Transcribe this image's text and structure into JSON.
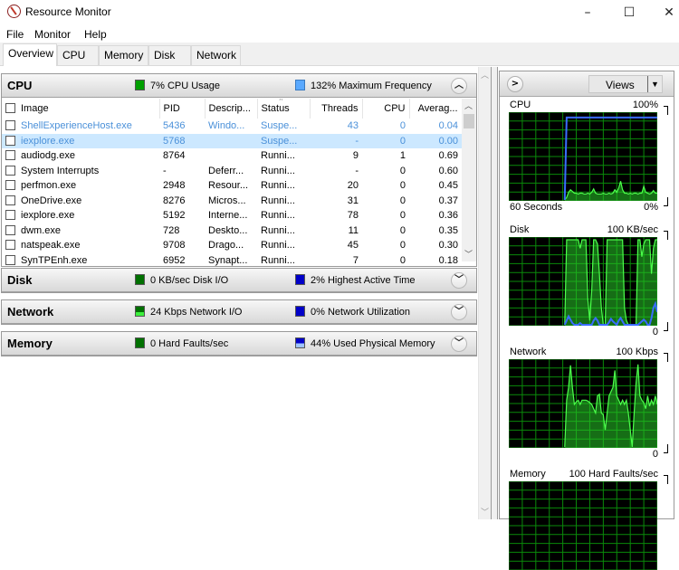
{
  "window": {
    "title": "Resource Monitor",
    "minimize": "–",
    "maximize": "☐",
    "close": "✕"
  },
  "menu": [
    "File",
    "Monitor",
    "Help"
  ],
  "tabs": [
    {
      "label": "Overview",
      "active": true
    },
    {
      "label": "CPU",
      "active": false
    },
    {
      "label": "Memory",
      "active": false
    },
    {
      "label": "Disk",
      "active": false
    },
    {
      "label": "Network",
      "active": false
    }
  ],
  "colors": {
    "green_indicator": "#00a000",
    "blue_indicator": "#0000c8",
    "light_blue_indicator": "#5aa9ff",
    "suspended_text": "#4a90d9",
    "selected_row": "#cce8ff",
    "graph_line_green": "#4cff4c",
    "graph_line_blue": "#3a6cff"
  },
  "cpu_section": {
    "title": "CPU",
    "stat1": "7% CPU Usage",
    "stat2": "132% Maximum Frequency",
    "expander": "^",
    "columns": [
      "Image",
      "PID",
      "Descrip...",
      "Status",
      "Threads",
      "CPU",
      "Averag..."
    ],
    "rows": [
      {
        "image": "ShellExperienceHost.exe",
        "pid": "5436",
        "desc": "Windo...",
        "status": "Suspe...",
        "threads": "43",
        "cpu": "0",
        "avg": "0.04",
        "state": "suspended"
      },
      {
        "image": "iexplore.exe",
        "pid": "5768",
        "desc": "",
        "status": "Suspe...",
        "threads": "-",
        "cpu": "0",
        "avg": "0.00",
        "state": "suspended-selected"
      },
      {
        "image": "audiodg.exe",
        "pid": "8764",
        "desc": "",
        "status": "Runni...",
        "threads": "9",
        "cpu": "1",
        "avg": "0.69",
        "state": "normal"
      },
      {
        "image": "System Interrupts",
        "pid": "-",
        "desc": "Deferr...",
        "status": "Runni...",
        "threads": "-",
        "cpu": "0",
        "avg": "0.60",
        "state": "normal"
      },
      {
        "image": "perfmon.exe",
        "pid": "2948",
        "desc": "Resour...",
        "status": "Runni...",
        "threads": "20",
        "cpu": "0",
        "avg": "0.45",
        "state": "normal"
      },
      {
        "image": "OneDrive.exe",
        "pid": "8276",
        "desc": "Micros...",
        "status": "Runni...",
        "threads": "31",
        "cpu": "0",
        "avg": "0.37",
        "state": "normal"
      },
      {
        "image": "iexplore.exe",
        "pid": "5192",
        "desc": "Interne...",
        "status": "Runni...",
        "threads": "78",
        "cpu": "0",
        "avg": "0.36",
        "state": "normal"
      },
      {
        "image": "dwm.exe",
        "pid": "728",
        "desc": "Deskto...",
        "status": "Runni...",
        "threads": "11",
        "cpu": "0",
        "avg": "0.35",
        "state": "normal"
      },
      {
        "image": "natspeak.exe",
        "pid": "9708",
        "desc": "Drago...",
        "status": "Runni...",
        "threads": "45",
        "cpu": "0",
        "avg": "0.30",
        "state": "normal"
      },
      {
        "image": "SynTPEnh.exe",
        "pid": "6952",
        "desc": "Synapt...",
        "status": "Runni...",
        "threads": "7",
        "cpu": "0",
        "avg": "0.18",
        "state": "normal"
      }
    ]
  },
  "disk_section": {
    "title": "Disk",
    "stat1": "0 KB/sec Disk I/O",
    "stat2": "2% Highest Active Time",
    "expander": "v"
  },
  "network_section": {
    "title": "Network",
    "stat1": "24 Kbps Network I/O",
    "stat2": "0% Network Utilization",
    "expander": "v"
  },
  "memory_section": {
    "title": "Memory",
    "stat1": "0 Hard Faults/sec",
    "stat2": "44% Used Physical Memory",
    "expander": "v"
  },
  "right_panel": {
    "collapse": ">",
    "views_label": "Views",
    "views_dropdown": "▼",
    "graphs": [
      {
        "name": "CPU",
        "max": "100%",
        "bottom_left": "60 Seconds",
        "bottom_right": "0%",
        "green": [
          0,
          0,
          0,
          0,
          0,
          0,
          0,
          0,
          0,
          0,
          0,
          0,
          0,
          0,
          0,
          0,
          0,
          0,
          0,
          0,
          0,
          0,
          0,
          0,
          0,
          0,
          0,
          0,
          0,
          0,
          0,
          0,
          0,
          0,
          0,
          0,
          0,
          0,
          0,
          0,
          0,
          0,
          0,
          0,
          0,
          0,
          0,
          0,
          0,
          0,
          0,
          0,
          0,
          0,
          0,
          0,
          0,
          0,
          0,
          0,
          0,
          0,
          0,
          0,
          0,
          0,
          0,
          0,
          0,
          0,
          0,
          0,
          0,
          0,
          0,
          0,
          0,
          0,
          0,
          0,
          0,
          0,
          0,
          0,
          0,
          0,
          0,
          0,
          0,
          0,
          0,
          0,
          0,
          0,
          0,
          0,
          0,
          0,
          0,
          0,
          0,
          0,
          0,
          0,
          0,
          0,
          0,
          0,
          0,
          0,
          0,
          0,
          0,
          0,
          0,
          0,
          0,
          0,
          0,
          0,
          0,
          0,
          0,
          0,
          0,
          0,
          0,
          0,
          0,
          0,
          0,
          0,
          0,
          0,
          0,
          0,
          0,
          0,
          0,
          0,
          0,
          0,
          0,
          0,
          0,
          0,
          0,
          0,
          0,
          0,
          0,
          0,
          0,
          0,
          0,
          0,
          0,
          0,
          0,
          0,
          0,
          0,
          0,
          0,
          0,
          0,
          0,
          0,
          0,
          0,
          0,
          0,
          0,
          0,
          0,
          0,
          0,
          0,
          0,
          0,
          0,
          0,
          0,
          0,
          0,
          0,
          0,
          0,
          0,
          0,
          0,
          0,
          0,
          0,
          0,
          0,
          0,
          0,
          0,
          0,
          0,
          0,
          0,
          0,
          0,
          0,
          0,
          0
        ],
        "green_series": [
          0,
          0,
          0,
          0,
          0,
          0,
          0,
          0,
          0,
          0,
          0,
          0,
          0,
          0,
          0,
          0,
          0,
          0,
          0,
          0,
          0,
          0,
          0,
          0,
          0,
          0,
          0,
          0,
          0,
          0,
          3,
          9,
          12,
          10,
          8,
          8,
          7,
          8,
          8,
          7,
          7,
          8,
          7,
          9,
          13,
          8,
          7,
          7,
          7,
          8,
          7,
          7,
          8,
          7,
          8,
          12,
          9,
          14,
          22,
          12,
          8,
          8,
          7,
          8,
          7,
          8,
          8,
          7,
          8,
          8,
          16,
          9,
          8,
          7,
          8,
          11,
          8,
          8
        ],
        "blue_series": [
          0,
          0,
          0,
          0,
          0,
          0,
          0,
          0,
          0,
          0,
          0,
          0,
          0,
          0,
          0,
          0,
          0,
          0,
          0,
          0,
          0,
          0,
          0,
          0,
          0,
          0,
          0,
          0,
          0,
          0,
          97,
          97,
          97,
          97,
          97,
          97,
          97,
          97,
          97,
          97,
          97,
          97,
          97,
          97,
          97,
          97,
          97,
          97,
          97,
          97,
          97,
          97,
          97,
          97,
          97,
          97,
          97,
          97,
          97,
          97,
          97,
          97,
          97,
          97,
          97,
          97,
          97,
          97,
          97,
          97,
          97,
          97,
          97,
          97,
          97,
          97,
          97,
          97
        ]
      },
      {
        "name": "Disk",
        "max": "100 KB/sec",
        "bottom_left": "",
        "bottom_right": "0",
        "green_series": [
          0,
          0,
          0,
          0,
          0,
          0,
          0,
          0,
          0,
          0,
          0,
          0,
          0,
          0,
          0,
          0,
          0,
          0,
          0,
          0,
          0,
          0,
          0,
          0,
          0,
          0,
          0,
          0,
          0,
          0,
          100,
          100,
          100,
          100,
          100,
          100,
          100,
          90,
          100,
          100,
          100,
          30,
          5,
          40,
          100,
          100,
          95,
          60,
          20,
          0,
          0,
          100,
          100,
          100,
          100,
          100,
          100,
          100,
          100,
          100,
          20,
          5,
          0,
          0,
          0,
          0,
          0,
          100,
          100,
          80,
          95,
          100,
          100,
          100,
          60,
          90,
          100,
          100
        ],
        "blue_series": [
          0,
          0,
          0,
          0,
          0,
          0,
          0,
          0,
          0,
          0,
          0,
          0,
          0,
          0,
          0,
          0,
          0,
          0,
          0,
          0,
          0,
          0,
          0,
          0,
          0,
          0,
          0,
          0,
          0,
          0,
          5,
          10,
          6,
          2,
          0,
          0,
          0,
          2,
          0,
          0,
          0,
          0,
          0,
          0,
          5,
          8,
          5,
          0,
          0,
          0,
          0,
          0,
          3,
          7,
          4,
          2,
          0,
          5,
          8,
          4,
          0,
          0,
          0,
          0,
          0,
          0,
          0,
          0,
          2,
          4,
          6,
          4,
          0,
          0,
          8,
          20,
          25,
          15
        ]
      },
      {
        "name": "Network",
        "max": "100 Kbps",
        "bottom_left": "",
        "bottom_right": "0",
        "green_series": [
          0,
          0,
          0,
          0,
          0,
          0,
          0,
          0,
          0,
          0,
          0,
          0,
          0,
          0,
          0,
          0,
          0,
          0,
          0,
          0,
          0,
          0,
          0,
          0,
          0,
          0,
          0,
          0,
          0,
          0,
          55,
          70,
          96,
          70,
          50,
          53,
          55,
          50,
          55,
          55,
          55,
          54,
          52,
          50,
          45,
          40,
          60,
          62,
          40,
          38,
          20,
          40,
          60,
          65,
          70,
          90,
          60,
          55,
          50,
          55,
          50,
          55,
          40,
          20,
          0,
          40,
          75,
          97,
          60,
          55,
          52,
          45,
          60,
          48,
          55,
          50,
          60,
          50
        ],
        "blue_series": []
      },
      {
        "name": "Memory",
        "max": "100 Hard Faults/sec",
        "bottom_left": "",
        "bottom_right": "",
        "green_series": [],
        "blue_series": []
      }
    ]
  }
}
